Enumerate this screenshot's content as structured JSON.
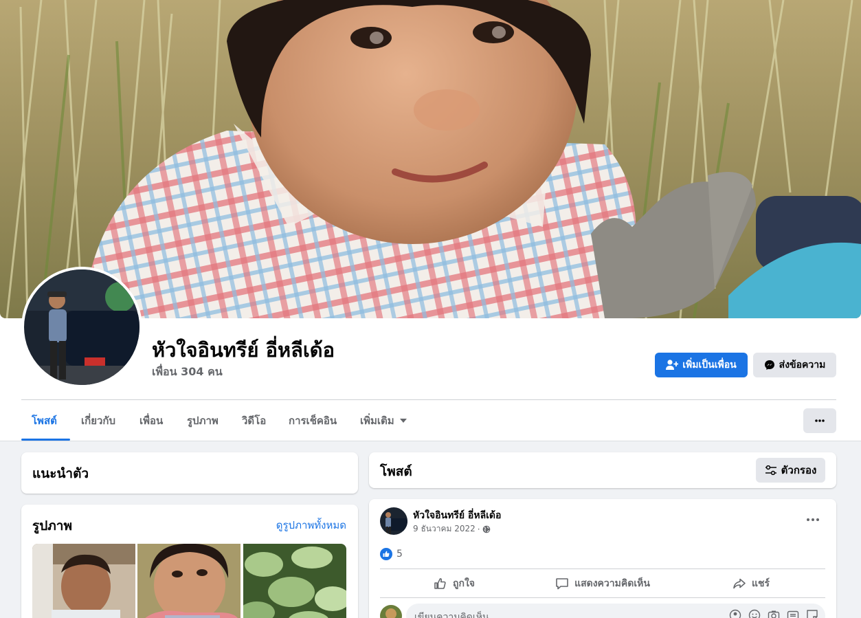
{
  "profile": {
    "name": "หัวใจอินทรีย์ อี่หลีเด้อ",
    "friends_text": "เพื่อน 304 คน"
  },
  "actions": {
    "add_friend_label": "เพิ่มเป็นเพื่อน",
    "message_label": "ส่งข้อความ"
  },
  "tabs": [
    {
      "label": "โพสต์",
      "active": true
    },
    {
      "label": "เกี่ยวกับ"
    },
    {
      "label": "เพื่อน"
    },
    {
      "label": "รูปภาพ"
    },
    {
      "label": "วิดีโอ"
    },
    {
      "label": "การเช็คอิน"
    },
    {
      "label": "เพิ่มเติม"
    }
  ],
  "intro": {
    "title": "แนะนำตัว"
  },
  "photos": {
    "title": "รูปภาพ",
    "see_all_label": "ดูรูปภาพทั้งหมด"
  },
  "posts_header": {
    "title": "โพสต์",
    "filter_label": "ตัวกรอง"
  },
  "post": {
    "author": "หัวใจอินทรีย์ อี่หลีเด้อ",
    "date": "9 ธันวาคม 2022",
    "separator": "·",
    "like_count": "5",
    "like_label": "ถูกใจ",
    "comment_label": "แสดงความคิดเห็น",
    "share_label": "แชร์",
    "comment_placeholder": "เขียนความคิดเห็น..."
  },
  "colors": {
    "accent": "#1b74e4",
    "page_bg": "#f0f2f5",
    "secondary_button": "#e4e6eb",
    "muted_text": "#65676b"
  },
  "icons": {
    "add_friend": "add-person-icon",
    "message": "messenger-icon",
    "more": "ellipsis-icon",
    "filter": "filter-sliders-icon",
    "privacy": "globe-icon",
    "like": "thumbs-up-icon",
    "comment": "speech-bubble-icon",
    "share": "share-arrow-icon"
  }
}
